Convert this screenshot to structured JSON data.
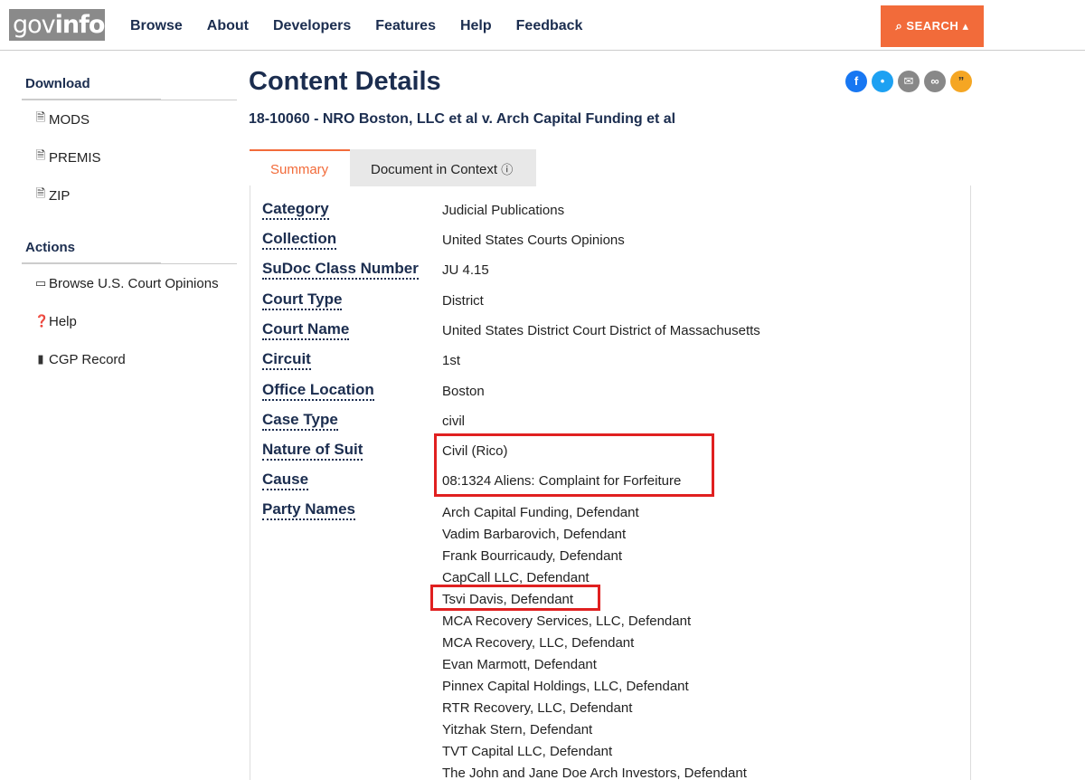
{
  "header": {
    "logo_prefix": "gov",
    "logo_suffix": "info",
    "nav": [
      "Browse",
      "About",
      "Developers",
      "Features",
      "Help",
      "Feedback"
    ],
    "search_label": "SEARCH"
  },
  "sidebar": {
    "download_title": "Download",
    "download_items": [
      "MODS",
      "PREMIS",
      "ZIP"
    ],
    "actions_title": "Actions",
    "action_items": [
      "Browse U.S. Court Opinions",
      "Help",
      "CGP Record"
    ]
  },
  "main": {
    "title": "Content Details",
    "subtitle": "18-10060 - NRO Boston, LLC et al v. Arch Capital Funding et al",
    "tabs": [
      "Summary",
      "Document in Context"
    ],
    "details": [
      {
        "label": "Category",
        "value": "Judicial Publications"
      },
      {
        "label": "Collection",
        "value": "United States Courts Opinions"
      },
      {
        "label": "SuDoc Class Number",
        "value": "JU 4.15"
      },
      {
        "label": "Court Type",
        "value": "District"
      },
      {
        "label": "Court Name",
        "value": "United States District Court District of Massachusetts"
      },
      {
        "label": "Circuit",
        "value": "1st"
      },
      {
        "label": "Office Location",
        "value": "Boston"
      },
      {
        "label": "Case Type",
        "value": "civil"
      },
      {
        "label": "Nature of Suit",
        "value": "Civil (Rico)"
      },
      {
        "label": "Cause",
        "value": "08:1324 Aliens: Complaint for Forfeiture"
      }
    ],
    "party_label": "Party Names",
    "parties": [
      "Arch Capital Funding, Defendant",
      "Vadim Barbarovich, Defendant",
      "Frank Bourricaudy, Defendant",
      "CapCall LLC, Defendant",
      "Tsvi Davis, Defendant",
      "MCA Recovery Services, LLC, Defendant",
      "MCA Recovery, LLC, Defendant",
      "Evan Marmott, Defendant",
      "Pinnex Capital Holdings, LLC, Defendant",
      "RTR Recovery, LLC, Defendant",
      "Yitzhak Stern, Defendant",
      "TVT Capital LLC, Defendant",
      "The John and Jane Doe Arch Investors, Defendant"
    ]
  },
  "colors": {
    "accent": "#f26b3a",
    "navy": "#1b2d4f",
    "highlight": "#e02020"
  }
}
